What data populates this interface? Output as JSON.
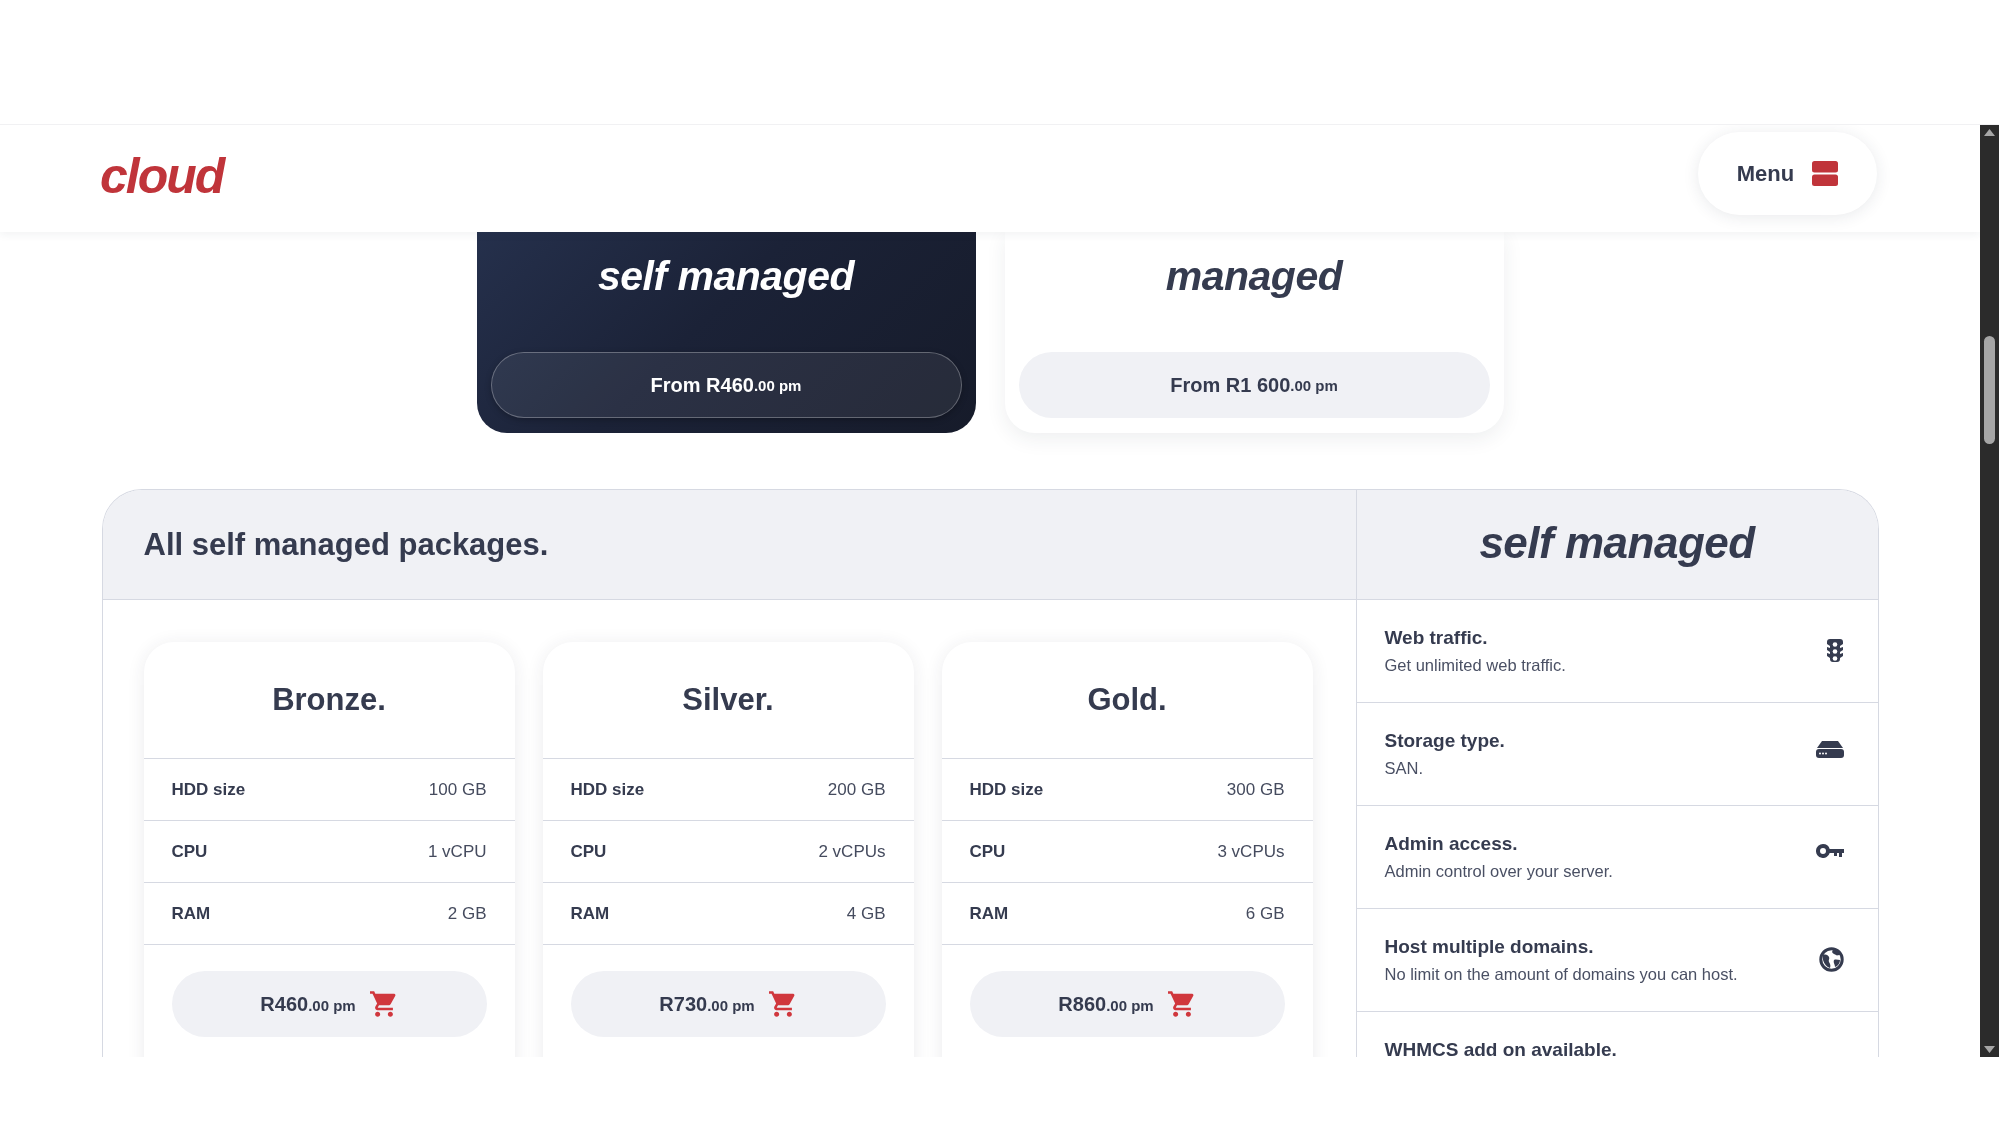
{
  "header": {
    "logo": "cloud",
    "menu_button": "Menu"
  },
  "plans": [
    {
      "title": "self managed",
      "price": "From R460",
      "price_suffix": ".00 pm",
      "selected": true
    },
    {
      "title": "managed",
      "price": "From R1 600",
      "price_suffix": ".00 pm",
      "selected": false
    }
  ],
  "packages_panel": {
    "title": "All self managed packages.",
    "packages": [
      {
        "name": "Bronze.",
        "specs": [
          {
            "label": "HDD size",
            "value": "100 GB"
          },
          {
            "label": "CPU",
            "value": "1 vCPU"
          },
          {
            "label": "RAM",
            "value": "2 GB"
          }
        ],
        "price": "R460",
        "price_suffix": ".00 pm"
      },
      {
        "name": "Silver.",
        "specs": [
          {
            "label": "HDD size",
            "value": "200 GB"
          },
          {
            "label": "CPU",
            "value": "2 vCPUs"
          },
          {
            "label": "RAM",
            "value": "4 GB"
          }
        ],
        "price": "R730",
        "price_suffix": ".00 pm"
      },
      {
        "name": "Gold.",
        "specs": [
          {
            "label": "HDD size",
            "value": "300 GB"
          },
          {
            "label": "CPU",
            "value": "3 vCPUs"
          },
          {
            "label": "RAM",
            "value": "6 GB"
          }
        ],
        "price": "R860",
        "price_suffix": ".00 pm"
      }
    ]
  },
  "features_panel": {
    "title": "self managed",
    "features": [
      {
        "kind": "traffic",
        "title": "Web traffic.",
        "description": "Get unlimited web traffic."
      },
      {
        "kind": "storage",
        "title": "Storage type.",
        "description": "SAN."
      },
      {
        "kind": "access",
        "title": "Admin access.",
        "description": "Admin control over your server."
      },
      {
        "kind": "domains",
        "title": "Host multiple domains.",
        "description": "No limit on the amount of domains you can host."
      },
      {
        "title": "WHMCS add on available."
      }
    ]
  }
}
